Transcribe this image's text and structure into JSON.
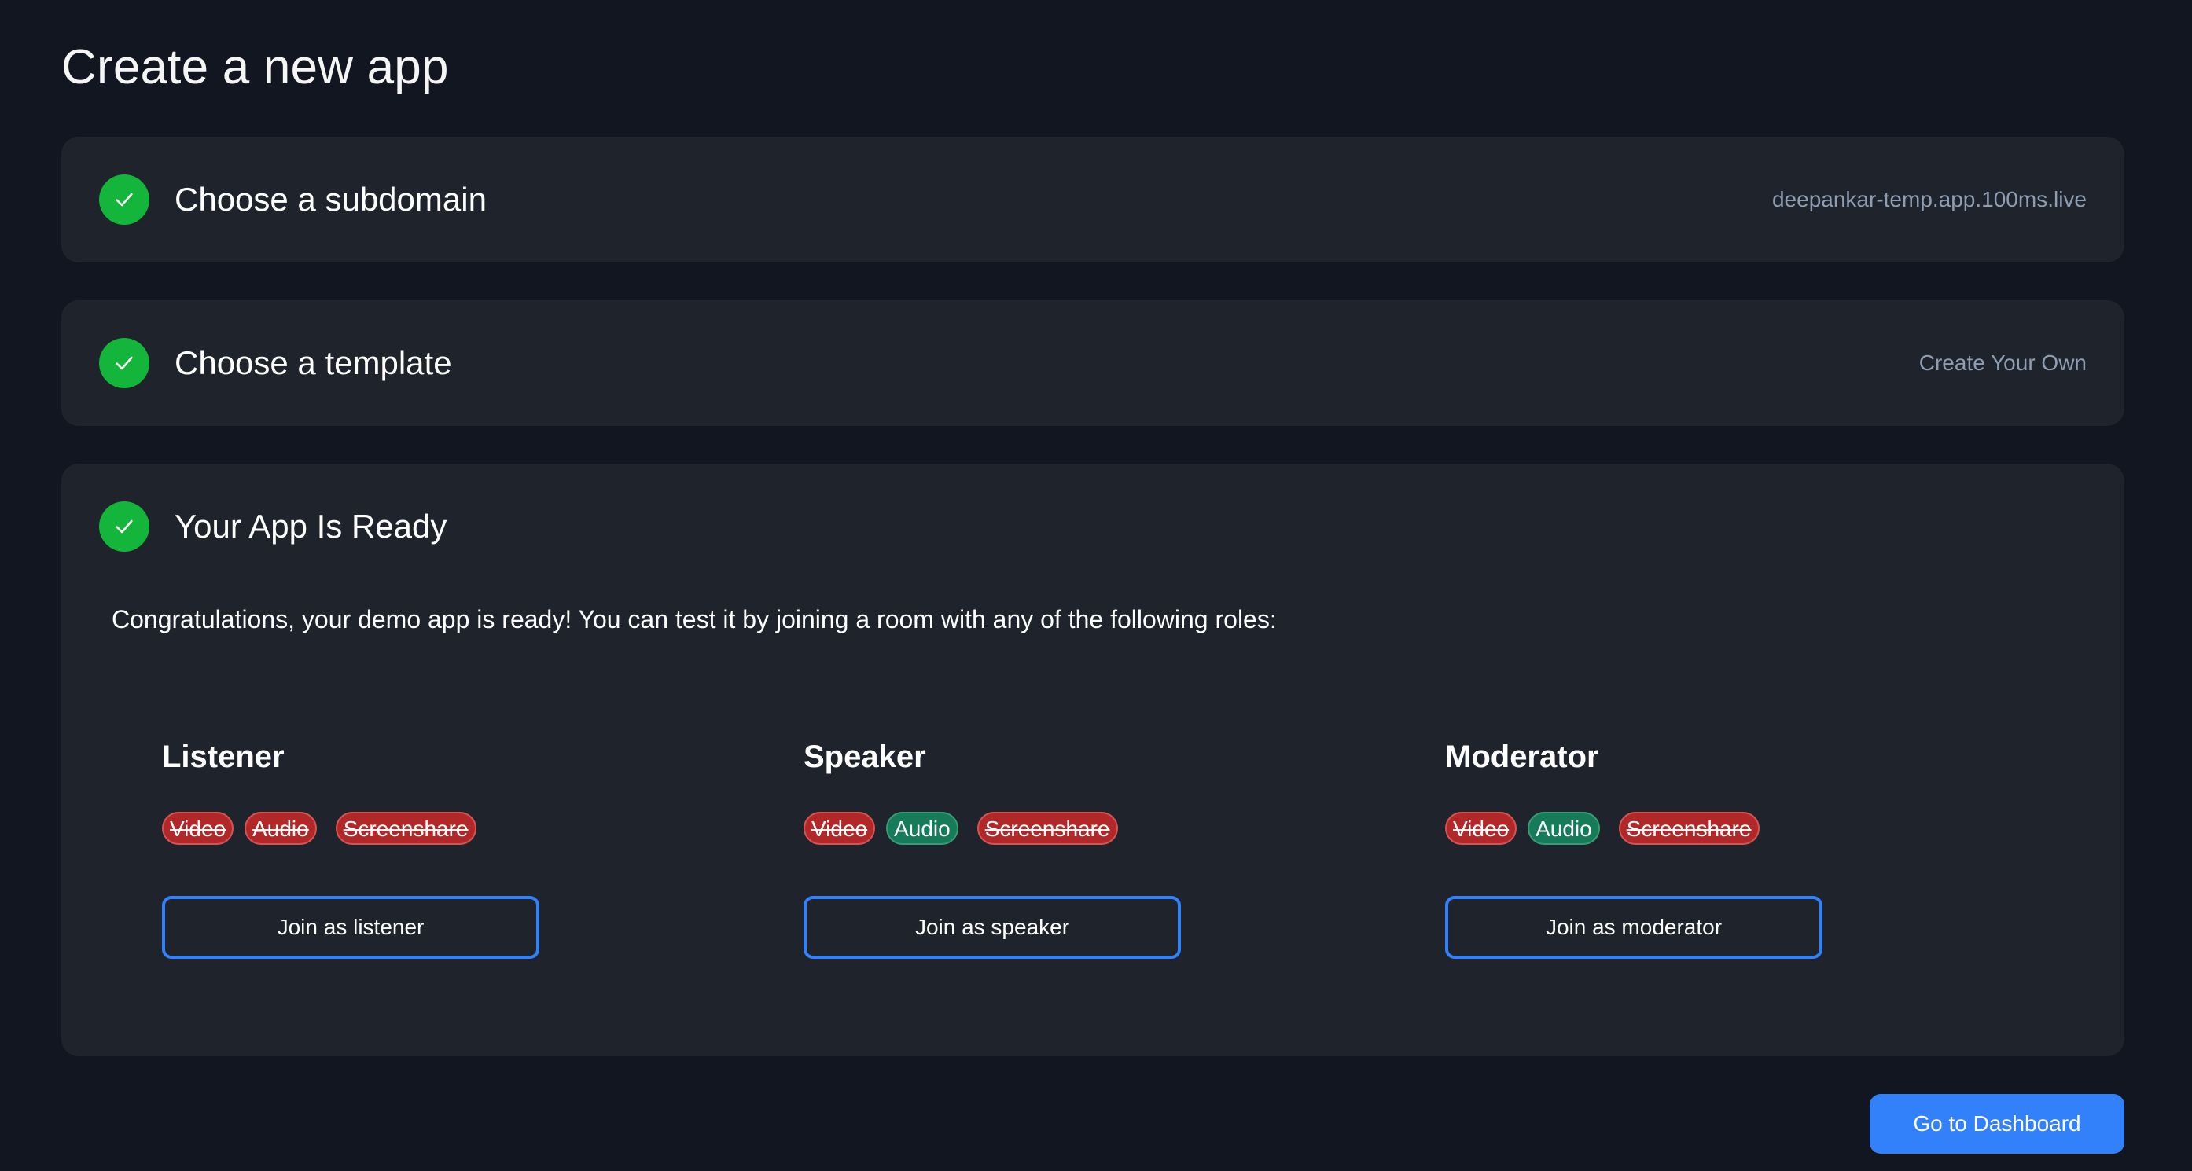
{
  "page": {
    "title": "Create a new app"
  },
  "steps": [
    {
      "title": "Choose a subdomain",
      "value": "deepankar-temp.app.100ms.live",
      "status": "complete",
      "icon": "check-icon"
    },
    {
      "title": "Choose a template",
      "value": "Create Your Own",
      "status": "complete",
      "icon": "check-icon"
    },
    {
      "title": "Your App Is Ready",
      "status": "complete",
      "icon": "check-icon",
      "message": "Congratulations, your demo app is ready! You can test it by joining a room with any of the following roles:"
    }
  ],
  "roles": [
    {
      "name": "Listener",
      "permissions": [
        {
          "label": "Video",
          "enabled": false
        },
        {
          "label": "Audio",
          "enabled": false
        },
        {
          "label": "Screenshare",
          "enabled": false
        }
      ],
      "join_label": "Join as listener"
    },
    {
      "name": "Speaker",
      "permissions": [
        {
          "label": "Video",
          "enabled": false
        },
        {
          "label": "Audio",
          "enabled": true
        },
        {
          "label": "Screenshare",
          "enabled": false
        }
      ],
      "join_label": "Join as speaker"
    },
    {
      "name": "Moderator",
      "permissions": [
        {
          "label": "Video",
          "enabled": false
        },
        {
          "label": "Audio",
          "enabled": true
        },
        {
          "label": "Screenshare",
          "enabled": false
        }
      ],
      "join_label": "Join as moderator"
    }
  ],
  "footer": {
    "dashboard_label": "Go to Dashboard"
  },
  "colors": {
    "background": "#111620",
    "card": "#1e232c",
    "success": "#13b53b",
    "disabled_badge": "#b22828",
    "enabled_badge": "#167b58",
    "accent": "#3381fa",
    "muted_text": "#8f9db3"
  }
}
